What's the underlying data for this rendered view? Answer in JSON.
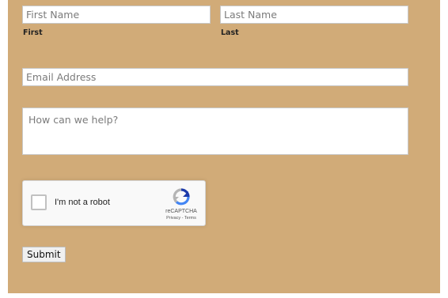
{
  "form": {
    "first_name": {
      "placeholder": "First Name",
      "sublabel": "First"
    },
    "last_name": {
      "placeholder": "Last Name",
      "sublabel": "Last"
    },
    "email": {
      "placeholder": "Email Address"
    },
    "message": {
      "placeholder": "How can we help?"
    },
    "captcha": {
      "checkbox_label": "I'm not a robot",
      "brand": "reCAPTCHA",
      "links": "Privacy - Terms",
      "icon": "recaptcha-logo-icon"
    },
    "submit_label": "Submit"
  },
  "colors": {
    "panel_background": "#d1ab78",
    "field_background": "#ffffff",
    "placeholder_text": "#7b7b7b"
  }
}
